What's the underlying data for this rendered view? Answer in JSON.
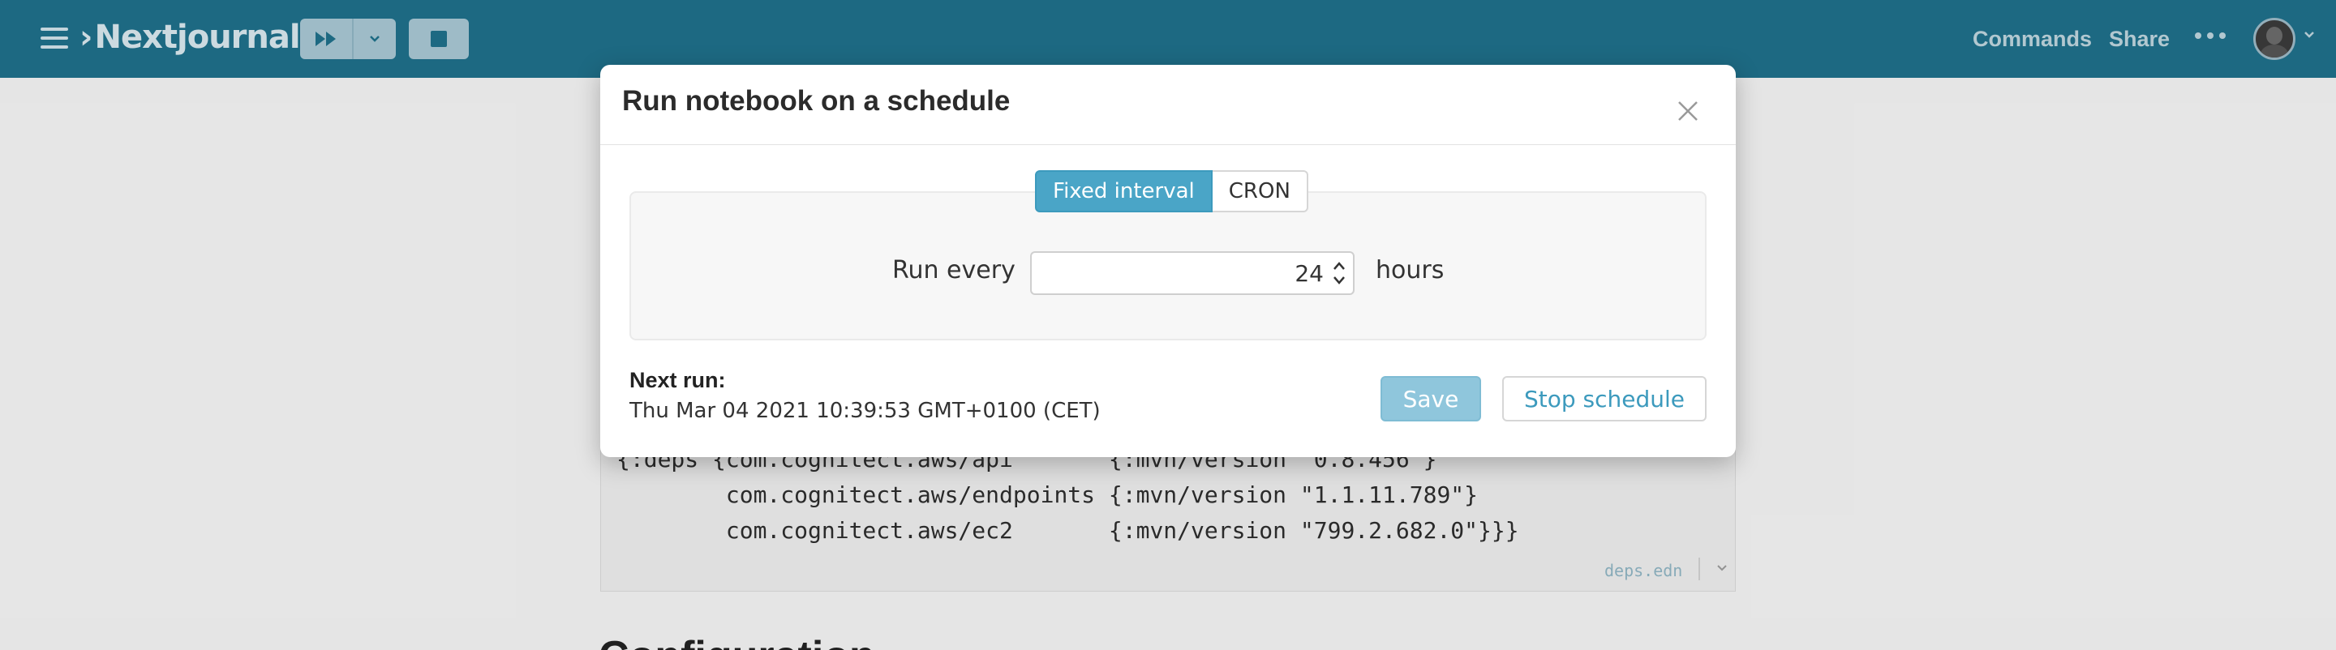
{
  "app": {
    "brand_prefix": "›",
    "brand_name": "Nextjournal",
    "nav_commands": "Commands",
    "nav_share": "Share"
  },
  "background_code": {
    "lines": [
      "{:deps {com.cognitect.aws/api       {:mvn/version \"0.8.456\"}",
      "        com.cognitect.aws/endpoints {:mvn/version \"1.1.11.789\"}",
      "        com.cognitect.aws/ec2       {:mvn/version \"799.2.682.0\"}}}"
    ],
    "filename": "deps.edn",
    "next_heading": "Configuration"
  },
  "modal": {
    "title": "Run notebook on a schedule",
    "tabs": [
      "Fixed interval",
      "CRON"
    ],
    "active_tab": "Fixed interval",
    "run_every_label": "Run every",
    "interval_value": "24",
    "interval_unit": "hours",
    "next_run_label": "Next run:",
    "next_run_value": "Thu Mar 04 2021 10:39:53 GMT+0100 (CET)",
    "save_label": "Save",
    "stop_label": "Stop schedule"
  },
  "colors": {
    "topbar": "#1f6f89",
    "accent": "#4aa5c7",
    "save_disabled": "#8fc6dc"
  }
}
